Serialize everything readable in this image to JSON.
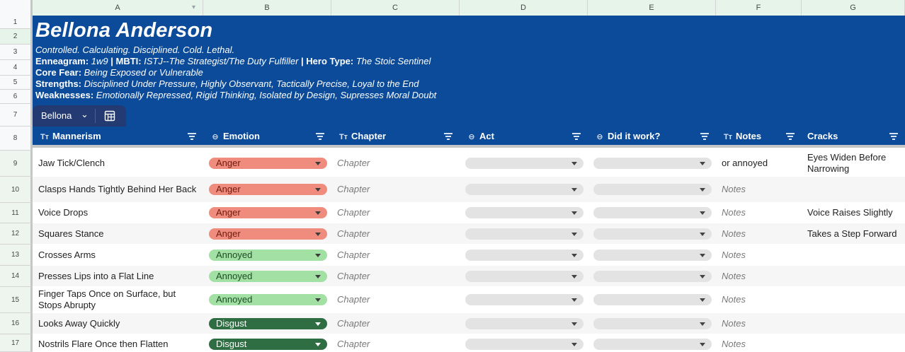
{
  "columns": [
    "A",
    "B",
    "C",
    "D",
    "E",
    "F",
    "G"
  ],
  "row_numbers": [
    "1",
    "2",
    "3",
    "4",
    "5",
    "6",
    "7",
    "8",
    "9",
    "10",
    "11",
    "12",
    "13",
    "14",
    "15",
    "16",
    "17"
  ],
  "banner": {
    "name": "Bellona Anderson",
    "tagline": "Controlled. Calculating. Disciplined. Cold. Lethal.",
    "enneagram_label": "Enneagram",
    "enneagram_value": "1w9",
    "mbti_label": "MBTI",
    "mbti_value": "ISTJ--The Strategist/The Duty Fulfiller",
    "hero_label": "Hero Type",
    "hero_value": "The Stoic Sentinel",
    "fear_label": "Core Fear",
    "fear_value": "Being Exposed or Vulnerable",
    "strengths_label": "Strengths",
    "strengths_value": "Disciplined Under Pressure, Highly Observant, Tactically Precise, Loyal to the End",
    "weaknesses_label": "Weaknesses",
    "weaknesses_value": "Emotionally Repressed, Rigid Thinking, Isolated by Design, Supresses Moral Doubt"
  },
  "table_tab": {
    "name": "Bellona"
  },
  "headers": {
    "mannerism": "Mannerism",
    "emotion": "Emotion",
    "chapter": "Chapter",
    "act": "Act",
    "did_it_work": "Did it work?",
    "notes": "Notes",
    "cracks": "Cracks"
  },
  "header_icons": {
    "text": "Tт"
  },
  "rows": [
    {
      "mannerism": "Jaw Tick/Clench",
      "emotion": "Anger",
      "chapter": "Chapter",
      "notes": "or annoyed",
      "cracks": "Eyes Widen Before Narrowing"
    },
    {
      "mannerism": "Clasps Hands Tightly Behind Her Back",
      "emotion": "Anger",
      "chapter": "Chapter",
      "notes": "Notes",
      "cracks": ""
    },
    {
      "mannerism": "Voice Drops",
      "emotion": "Anger",
      "chapter": "Chapter",
      "notes": "Notes",
      "cracks": "Voice Raises Slightly"
    },
    {
      "mannerism": "Squares Stance",
      "emotion": "Anger",
      "chapter": "Chapter",
      "notes": "Notes",
      "cracks": "Takes a Step Forward"
    },
    {
      "mannerism": "Crosses Arms",
      "emotion": "Annoyed",
      "chapter": "Chapter",
      "notes": "Notes",
      "cracks": ""
    },
    {
      "mannerism": "Presses Lips into a Flat Line",
      "emotion": "Annoyed",
      "chapter": "Chapter",
      "notes": "Notes",
      "cracks": ""
    },
    {
      "mannerism": "Finger Taps Once on Surface, but Stops Abrupty",
      "emotion": "Annoyed",
      "chapter": "Chapter",
      "notes": "Notes",
      "cracks": ""
    },
    {
      "mannerism": "Looks Away Quickly",
      "emotion": "Disgust",
      "chapter": "Chapter",
      "notes": "Notes",
      "cracks": ""
    },
    {
      "mannerism": "Nostrils Flare Once then Flatten",
      "emotion": "Disgust",
      "chapter": "Chapter",
      "notes": "Notes",
      "cracks": ""
    }
  ],
  "colors": {
    "banner": "#0b4b9a",
    "anger": "#f08c7d",
    "annoyed": "#a2e0a4",
    "disgust": "#2e6e42"
  }
}
